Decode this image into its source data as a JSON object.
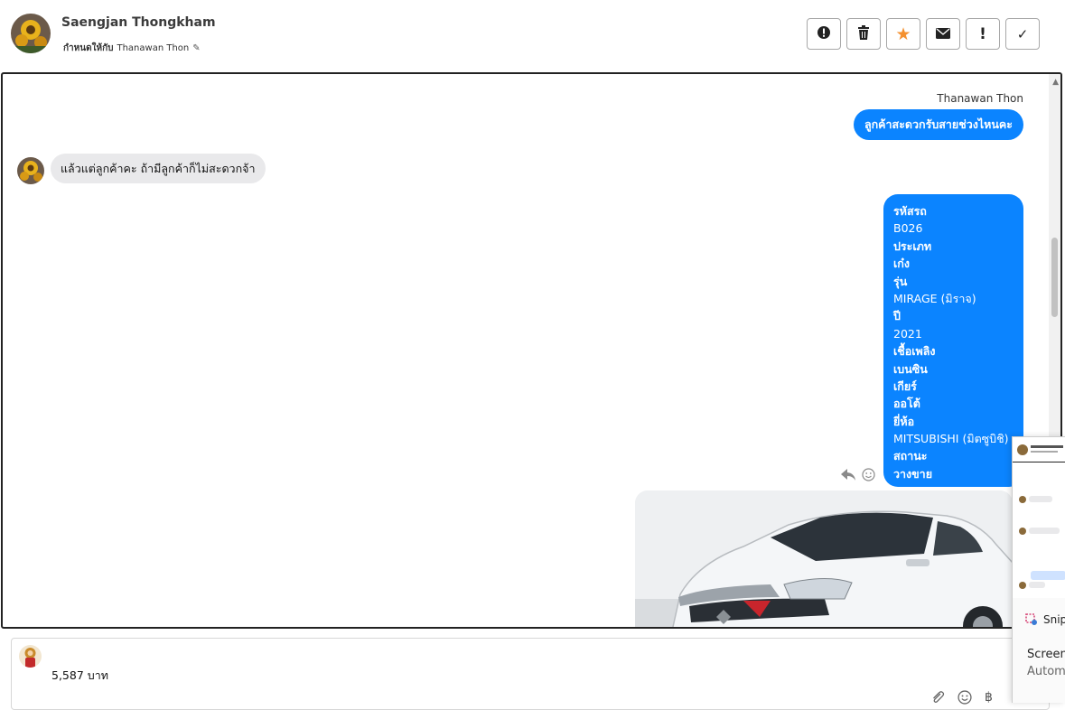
{
  "header": {
    "contact_name": "Saengjan Thongkham",
    "assign_prefix": "กำหนดให้กับ",
    "assignee": "Thanawan Thon"
  },
  "actions": [
    {
      "name": "alert-circle-icon",
      "glyph": "❗"
    },
    {
      "name": "trash-icon",
      "glyph": "🗑"
    },
    {
      "name": "star-icon",
      "glyph": "★"
    },
    {
      "name": "envelope-icon",
      "glyph": "✉"
    },
    {
      "name": "exclamation-icon",
      "glyph": "!"
    },
    {
      "name": "check-icon",
      "glyph": "✓"
    }
  ],
  "chat": {
    "sender_name": "Thanawan Thon",
    "out_message_1": "ลูกค้าสะดวกรับสายช่วงไหนคะ",
    "in_message_1": "แล้วแต่ลูกค้าคะ ถ้ามีลูกค้าก็ไม่สะดวกจ้า",
    "car_details": [
      "รหัสรถ",
      "B026",
      "ประเภท",
      "เก๋ง",
      "รุ่น",
      "MIRAGE (มิราจ)",
      "ปี",
      "2021",
      "เชื้อเพลิง",
      "เบนซิน",
      "เกียร์",
      "ออโต้",
      "ยี่ห้อ",
      "MITSUBISHI (มิตซูบิชิ)",
      "สถานะ",
      "วางขาย"
    ],
    "message_tools": [
      "reply-icon",
      "emoji-icon"
    ]
  },
  "composer": {
    "text": "5,587 บาท",
    "tools": [
      "paperclip-icon",
      "emoji-icon",
      "baht-icon"
    ]
  },
  "snip_overlay": {
    "app_name": "Snip",
    "title": "Screens",
    "subtitle": "Automa"
  },
  "colors": {
    "outgoing_bubble": "#0b84ff",
    "incoming_bubble": "#e9e9eb",
    "star_accent": "#f4902f"
  }
}
